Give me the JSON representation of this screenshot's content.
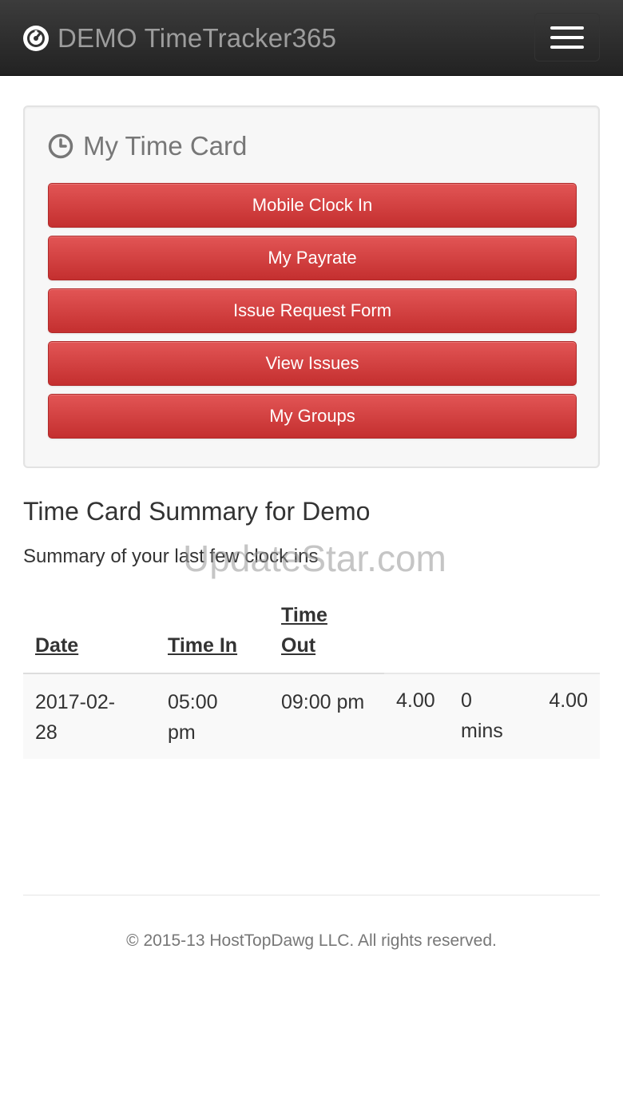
{
  "navbar": {
    "brand": "DEMO TimeTracker365",
    "brand_icon": "dashboard-icon",
    "menu_icon": "hamburger-menu-icon"
  },
  "time_card": {
    "title": "My Time Card",
    "title_icon": "clock-icon",
    "buttons": [
      {
        "label": "Mobile Clock In"
      },
      {
        "label": "My Payrate"
      },
      {
        "label": "Issue Request Form"
      },
      {
        "label": "View Issues"
      },
      {
        "label": "My Groups"
      }
    ]
  },
  "summary": {
    "heading": "Time Card Summary for Demo",
    "subtitle": "Summary of your last few clock ins",
    "watermark": "UpdateStar.com",
    "columns": [
      "Date",
      "Time In",
      "Time Out"
    ],
    "rows": [
      {
        "date": "2017-02-28",
        "time_in": "05:00 pm",
        "time_out": "09:00 pm",
        "hours": "4.00",
        "break": "0 mins",
        "total": "4.00"
      }
    ]
  },
  "footer": {
    "copyright": "© 2015-13 HostTopDawg LLC. All rights reserved."
  },
  "colors": {
    "navbar_bg": "#222222",
    "button_red": "#d9534f",
    "panel_bg": "#f7f7f7"
  }
}
